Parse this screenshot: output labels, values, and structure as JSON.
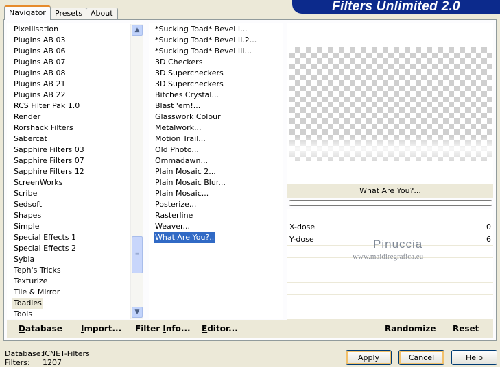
{
  "title": "Filters Unlimited 2.0",
  "tabs": [
    "Navigator",
    "Presets",
    "About"
  ],
  "categories": [
    "Pixellisation",
    "Plugins AB 03",
    "Plugins AB 06",
    "Plugins AB 07",
    "Plugins AB 08",
    "Plugins AB 21",
    "Plugins AB 22",
    "RCS Filter Pak 1.0",
    "Render",
    "Rorshack Filters",
    "Sabercat",
    "Sapphire Filters 03",
    "Sapphire Filters 07",
    "Sapphire Filters 12",
    "ScreenWorks",
    "Scribe",
    "Sedsoft",
    "Shapes",
    "Simple",
    "Special Effects 1",
    "Special Effects 2",
    "Sybia",
    "Teph's Tricks",
    "Texturize",
    "Tile & Mirror",
    "Toadies",
    "Tools"
  ],
  "selected_category": "Toadies",
  "filters": [
    "*Sucking Toad*  Bevel I...",
    "*Sucking Toad*  Bevel II.2...",
    "*Sucking Toad*  Bevel III...",
    "3D Checkers",
    "3D Supercheckers",
    "3D Supercheckers",
    "Bitches Crystal...",
    "Blast 'em!...",
    "Glasswork Colour",
    "Metalwork...",
    "Motion Trail...",
    "Old Photo...",
    "Ommadawn...",
    "Plain Mosaic 2...",
    "Plain Mosaic Blur...",
    "Plain Mosaic...",
    "Posterize...",
    "Rasterline",
    "Weaver...",
    "What Are You?..."
  ],
  "selected_filter": "What Are You?...",
  "current_filter_name": "What Are You?...",
  "params": [
    {
      "name": "X-dose",
      "value": "0"
    },
    {
      "name": "Y-dose",
      "value": "6"
    }
  ],
  "watermark": {
    "name": "Pinuccia",
    "url": "www.maidiregrafica.eu"
  },
  "actions": {
    "database": {
      "u": "D",
      "rest": "atabase"
    },
    "import": {
      "u": "I",
      "rest": "mport..."
    },
    "filter_info": {
      "pre": "Filter ",
      "u": "I",
      "rest": "nfo..."
    },
    "editor": {
      "u": "E",
      "rest": "ditor..."
    },
    "randomize": "Randomize",
    "reset": "Reset"
  },
  "footer": {
    "database_label": "Database:",
    "database_value": "ICNET-Filters",
    "filters_label": "Filters:",
    "filters_value": "1207"
  },
  "buttons": {
    "apply": "Apply",
    "cancel": "Cancel",
    "help": "Help"
  }
}
